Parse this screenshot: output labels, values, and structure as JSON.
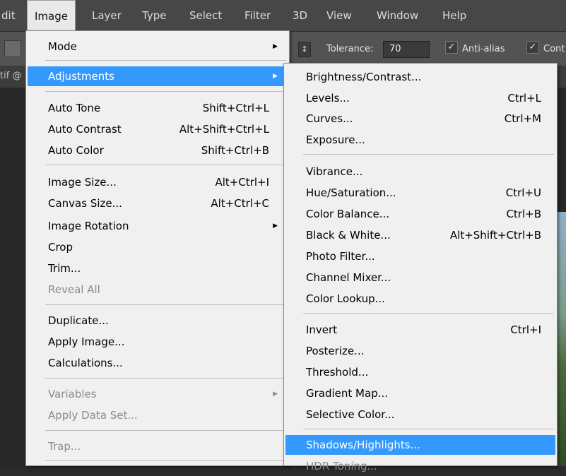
{
  "menubar": {
    "items": [
      "dit",
      "Image",
      "Layer",
      "Type",
      "Select",
      "Filter",
      "3D",
      "View",
      "Window",
      "Help"
    ],
    "active": "Image"
  },
  "options_bar": {
    "tolerance_label": "Tolerance:",
    "tolerance_value": "70",
    "anti_alias_label": "Anti-alias",
    "contiguous_label": "Cont",
    "spin_glyph": "↕"
  },
  "doc_tab": {
    "title_fragment": "tif @"
  },
  "image_menu": {
    "mode": "Mode",
    "adjustments": "Adjustments",
    "auto_tone": {
      "label": "Auto Tone",
      "shortcut": "Shift+Ctrl+L"
    },
    "auto_contrast": {
      "label": "Auto Contrast",
      "shortcut": "Alt+Shift+Ctrl+L"
    },
    "auto_color": {
      "label": "Auto Color",
      "shortcut": "Shift+Ctrl+B"
    },
    "image_size": {
      "label": "Image Size...",
      "shortcut": "Alt+Ctrl+I"
    },
    "canvas_size": {
      "label": "Canvas Size...",
      "shortcut": "Alt+Ctrl+C"
    },
    "image_rotation": "Image Rotation",
    "crop": "Crop",
    "trim": "Trim...",
    "reveal_all": "Reveal All",
    "duplicate": "Duplicate...",
    "apply_image": "Apply Image...",
    "calculations": "Calculations...",
    "variables": "Variables",
    "apply_data_set": "Apply Data Set...",
    "trap": "Trap..."
  },
  "adjustments_menu": {
    "brightness_contrast": {
      "label": "Brightness/Contrast...",
      "shortcut": ""
    },
    "levels": {
      "label": "Levels...",
      "shortcut": "Ctrl+L"
    },
    "curves": {
      "label": "Curves...",
      "shortcut": "Ctrl+M"
    },
    "exposure": {
      "label": "Exposure...",
      "shortcut": ""
    },
    "vibrance": {
      "label": "Vibrance...",
      "shortcut": ""
    },
    "hue_saturation": {
      "label": "Hue/Saturation...",
      "shortcut": "Ctrl+U"
    },
    "color_balance": {
      "label": "Color Balance...",
      "shortcut": "Ctrl+B"
    },
    "black_white": {
      "label": "Black & White...",
      "shortcut": "Alt+Shift+Ctrl+B"
    },
    "photo_filter": {
      "label": "Photo Filter...",
      "shortcut": ""
    },
    "channel_mixer": {
      "label": "Channel Mixer...",
      "shortcut": ""
    },
    "color_lookup": {
      "label": "Color Lookup...",
      "shortcut": ""
    },
    "invert": {
      "label": "Invert",
      "shortcut": "Ctrl+I"
    },
    "posterize": {
      "label": "Posterize...",
      "shortcut": ""
    },
    "threshold": {
      "label": "Threshold...",
      "shortcut": ""
    },
    "gradient_map": {
      "label": "Gradient Map...",
      "shortcut": ""
    },
    "selective_color": {
      "label": "Selective Color...",
      "shortcut": ""
    },
    "shadows_highlights": {
      "label": "Shadows/Highlights...",
      "shortcut": ""
    },
    "hdr_toning": {
      "label": "HDR Toning...",
      "shortcut": ""
    }
  },
  "colors": {
    "highlight": "#3399ff",
    "menu_bg": "#f0f0f0",
    "app_bar": "#474747"
  }
}
